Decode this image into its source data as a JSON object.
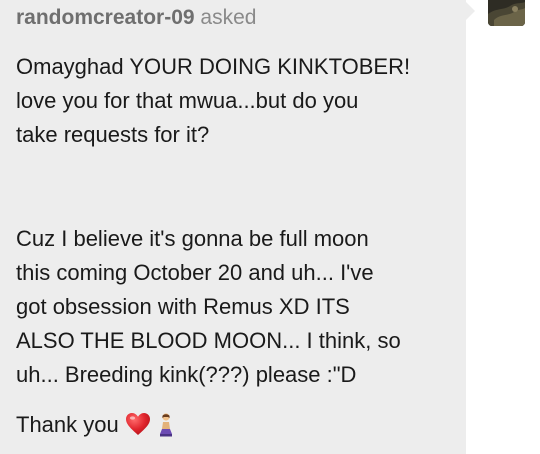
{
  "ask": {
    "username": "randomcreator-09",
    "verb": "asked",
    "paragraph1": "Omayghad YOUR DOING KINKTOBER!\nlove you for that mwua...but do you\ntake requests for it?",
    "paragraph2": "Cuz I believe it's gonna be full moon\nthis coming October 20 and uh... I've\ngot obsession with Remus XD ITS\nALSO THE BLOOD MOON... I think, so\nuh... Breeding kink(???) please :\"D",
    "closing": "Thank you"
  },
  "icons": {
    "heart": "heart-emoji-icon",
    "person": "person-kneeling-emoji-icon"
  },
  "colors": {
    "card_background": "#ededed",
    "heart": "#e0242c"
  }
}
